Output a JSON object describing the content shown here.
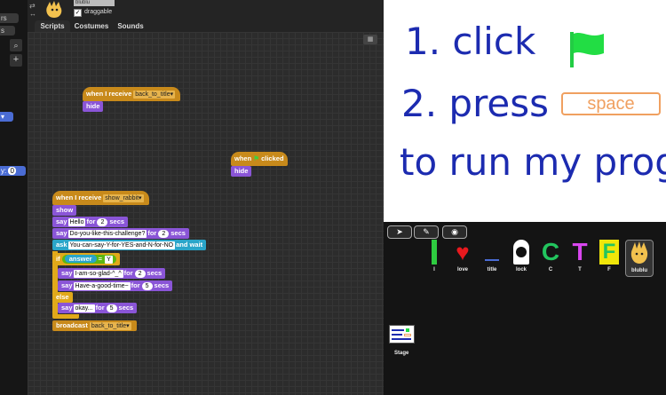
{
  "sprite": {
    "name": "blublu",
    "draggable_label": "draggable"
  },
  "tabs": [
    "Scripts",
    "Costumes",
    "Sounds"
  ],
  "palette": {
    "chip1": "rs",
    "chip2": "s",
    "var_label": "y:",
    "var_value": "0"
  },
  "scripts": {
    "s1": {
      "hat": "when I receive",
      "msg": "back_to_title",
      "b1": "hide"
    },
    "s2": {
      "hat_when": "when",
      "hat_clicked": "clicked",
      "b1": "hide"
    },
    "s3": {
      "hat": "when I receive",
      "msg": "show_rabbit",
      "show": "show",
      "say1": {
        "say": "say",
        "text": "Hello",
        "for": "for",
        "num": "2",
        "secs": "secs"
      },
      "say2": {
        "say": "say",
        "text": "Do-you-like-this-challenge?",
        "for": "for",
        "num": "2",
        "secs": "secs"
      },
      "ask": {
        "ask": "ask",
        "text": "You-can-say-Y-for-YES-and-N-for-NO",
        "wait": "and wait"
      },
      "if": {
        "if": "if",
        "answer": "answer",
        "eq": "=",
        "val": "Y"
      },
      "say3": {
        "say": "say",
        "text": "I-am-so-glad-^_^",
        "for": "for",
        "num": "2",
        "secs": "secs"
      },
      "say4": {
        "say": "say",
        "text": "Have-a-good-time~",
        "for": "for",
        "num": "5",
        "secs": "secs"
      },
      "else": "else",
      "say5": {
        "say": "say",
        "text": "okay...",
        "for": "for",
        "num": "5",
        "secs": "secs"
      },
      "broadcast": {
        "label": "broadcast",
        "msg": "back_to_title"
      }
    }
  },
  "stage": {
    "line1": "1. click",
    "line2": "2. press",
    "space": "space",
    "line3": "to run my progr"
  },
  "sprites": {
    "items": [
      {
        "label": "I",
        "color": "#2ecc40"
      },
      {
        "label": "love",
        "color": "#e8191e"
      },
      {
        "label": "title",
        "color": "#333333"
      },
      {
        "label": "lock",
        "color": "#ffffff"
      },
      {
        "label": "C",
        "color": "#22c55e"
      },
      {
        "label": "T",
        "color": "#d946ef"
      },
      {
        "label": "F",
        "color": "#f0e60a"
      },
      {
        "label": "blublu",
        "color": "#f2c14e"
      }
    ],
    "stage_label": "Stage"
  }
}
